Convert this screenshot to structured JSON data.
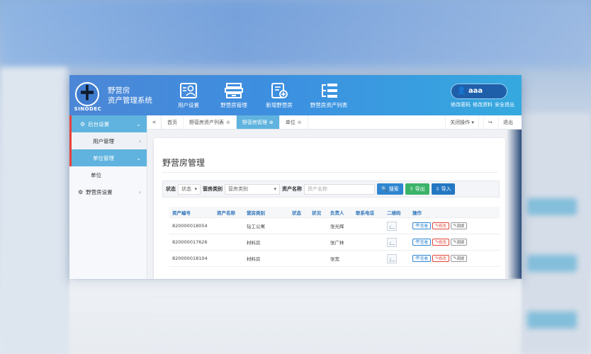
{
  "brand": {
    "logo_text": "SINODEC",
    "line1": "野营房",
    "line2": "资产管理系统"
  },
  "nav": [
    {
      "label": "用户设置",
      "icon": "user-card-icon"
    },
    {
      "label": "野营房管理",
      "icon": "cabinet-icon"
    },
    {
      "label": "新增野营房",
      "icon": "add-document-icon"
    },
    {
      "label": "野营房资产列表",
      "icon": "tree-list-icon"
    }
  ],
  "user": {
    "name": "aaa",
    "links": [
      "修改密码",
      "修改资料",
      "安全退出"
    ]
  },
  "sidebar": {
    "group1": "后台设置",
    "sub1": "用户管理",
    "sub2": "单位管理",
    "sub3": "单位",
    "group2": "野营房设置"
  },
  "tabs": {
    "back": "«",
    "items": [
      {
        "label": "首页"
      },
      {
        "label": "野营房资产列表"
      },
      {
        "label": "野营房管理"
      },
      {
        "label": "单位"
      }
    ],
    "close_ops": "关闭操作 ▾",
    "exit": "退出"
  },
  "panel": {
    "title": "野营房管理",
    "filter": {
      "status_label": "状态",
      "status_value": "状态",
      "type_label": "营房类别",
      "type_value": "营房类别",
      "name_label": "资产名称",
      "name_placeholder": "资产名称",
      "search": "搜索",
      "export": "导出",
      "import": "导入"
    }
  },
  "table": {
    "headers": [
      "资产编号",
      "资产名称",
      "营房类别",
      "状态",
      "状况",
      "负责人",
      "联系电话",
      "二维码",
      "操作"
    ],
    "rows": [
      {
        "code": "820000018054",
        "name": "",
        "type": "钻工公寓",
        "status": "",
        "cond": "",
        "owner": "张光辉",
        "phone": ""
      },
      {
        "code": "820000017626",
        "name": "",
        "type": "材料房",
        "status": "",
        "cond": "",
        "owner": "张广林",
        "phone": ""
      },
      {
        "code": "820000018104",
        "name": "",
        "type": "材料房",
        "status": "",
        "cond": "",
        "owner": "张宽",
        "phone": ""
      }
    ],
    "actions": {
      "view": "查看",
      "edit": "修改",
      "adjust": "调拨"
    }
  }
}
